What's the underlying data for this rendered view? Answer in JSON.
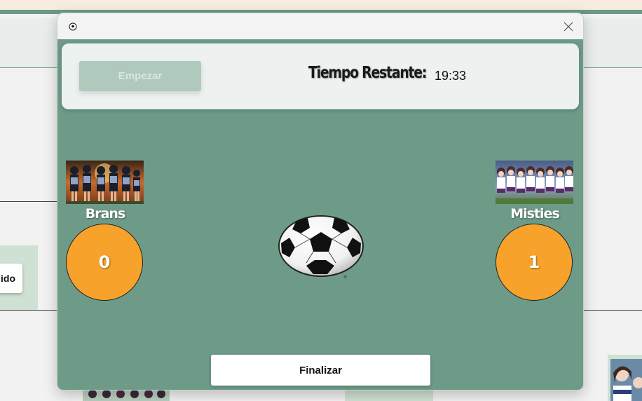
{
  "background": {
    "partial_button_label": "ido"
  },
  "window": {
    "icon": "soccer-ball-icon",
    "close_icon": "close-icon"
  },
  "controls": {
    "start_label": "Empezar",
    "timer_label": "Tiempo Restante:",
    "timer_value": "19:33",
    "finish_label": "Finalizar"
  },
  "teams": {
    "left": {
      "name": "Brans",
      "score": "0"
    },
    "right": {
      "name": "Misties",
      "score": "1"
    }
  },
  "colors": {
    "modal_bg": "#6d9b88",
    "score_bg": "#f7a22b",
    "start_disabled": "#afc9bd"
  }
}
